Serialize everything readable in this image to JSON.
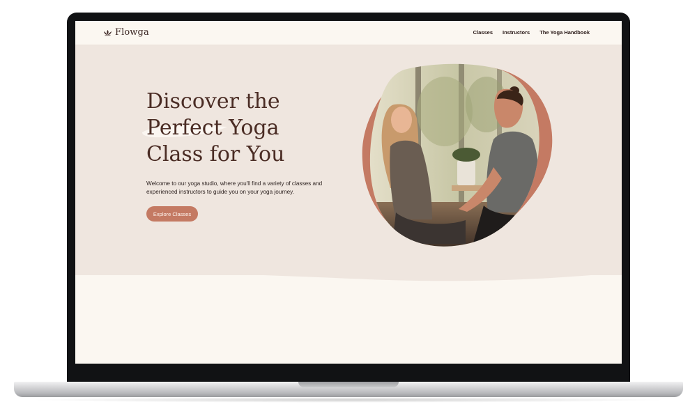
{
  "brand": {
    "name": "Flowga",
    "icon": "lotus-icon"
  },
  "nav": {
    "links": [
      "Classes",
      "Instructors",
      "The Yoga Handbook"
    ]
  },
  "hero": {
    "title_lines": [
      "Discover the",
      "Perfect Yoga",
      "Class for You"
    ],
    "description": "Welcome to our yoga studio, where you'll find a variety of classes and experienced instructors to guide you on your yoga journey.",
    "cta_label": "Explore Classes",
    "image": "photo-couple-smiling"
  },
  "colors": {
    "accent": "#c47a63",
    "hero_bg": "#efe6df",
    "page_bg": "#fbf7f1",
    "title": "#4a2c24"
  }
}
